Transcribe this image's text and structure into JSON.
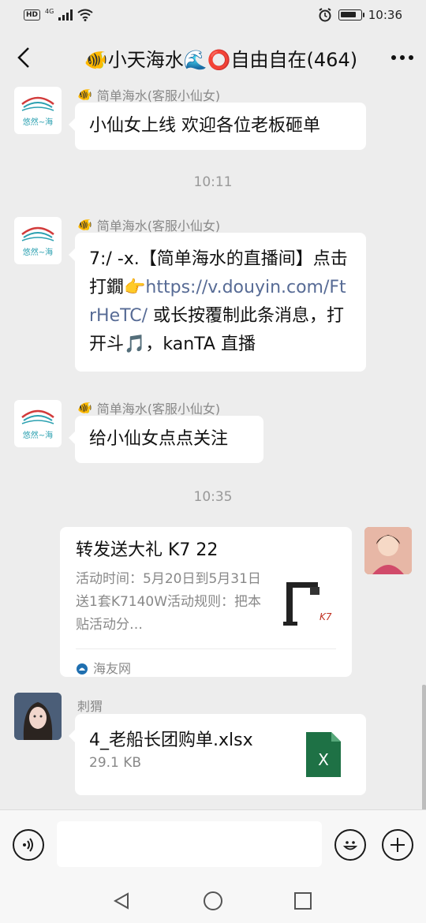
{
  "status_bar": {
    "hd": "HD",
    "network": "4G",
    "time": "10:36",
    "battery_level": 0.8
  },
  "header": {
    "back_icon": "chevron-left-icon",
    "title": "🐠小天海水🌊⭕自由自在(464)",
    "more_icon": "more-dots-icon"
  },
  "messages": [
    {
      "type": "text",
      "sender": "简单海水(客服小仙女)",
      "sender_emoji": "🐠",
      "avatar_text": "悠然~海",
      "text": "小仙女上线 欢迎各位老板砸单"
    },
    {
      "type": "time",
      "text": "10:11"
    },
    {
      "type": "text",
      "sender": "简单海水(客服小仙女)",
      "sender_emoji": "🐠",
      "avatar_text": "悠然~海",
      "text_parts": {
        "pre": "7:/ -x.【简单海水的直播间】点击打鐗👉",
        "link": "https://v.douyin.com/FtrHeTC/",
        "post": "  或长按覆制此条消息，打开斗🎵，kanTA 直播"
      }
    },
    {
      "type": "text",
      "sender": "简单海水(客服小仙女)",
      "sender_emoji": "🐠",
      "avatar_text": "悠然~海",
      "text": "给小仙女点点关注"
    },
    {
      "type": "time",
      "text": "10:35"
    },
    {
      "type": "link_card",
      "title": "转发送大礼 K7 22",
      "description": "活动时间：5月20日到5月31日送1套K7140W活动规则：把本贴活动分…",
      "source": "海友网",
      "thumb_label": "K7"
    },
    {
      "type": "file",
      "sender": "刺猬",
      "file_name": "4_老船长团购单.xlsx",
      "file_size": "29.1 KB",
      "file_icon_letter": "X"
    }
  ],
  "input_bar": {
    "voice_icon": "voice-icon",
    "placeholder": "",
    "emoji_icon": "emoji-icon",
    "plus_icon": "plus-icon"
  },
  "nav_bar": {
    "back_icon": "triangle-back-icon",
    "home_icon": "circle-home-icon",
    "recent_icon": "square-recent-icon"
  },
  "colors": {
    "background": "#ededed",
    "bubble": "#ffffff",
    "link": "#576b95",
    "excel_green": "#1e7145"
  }
}
